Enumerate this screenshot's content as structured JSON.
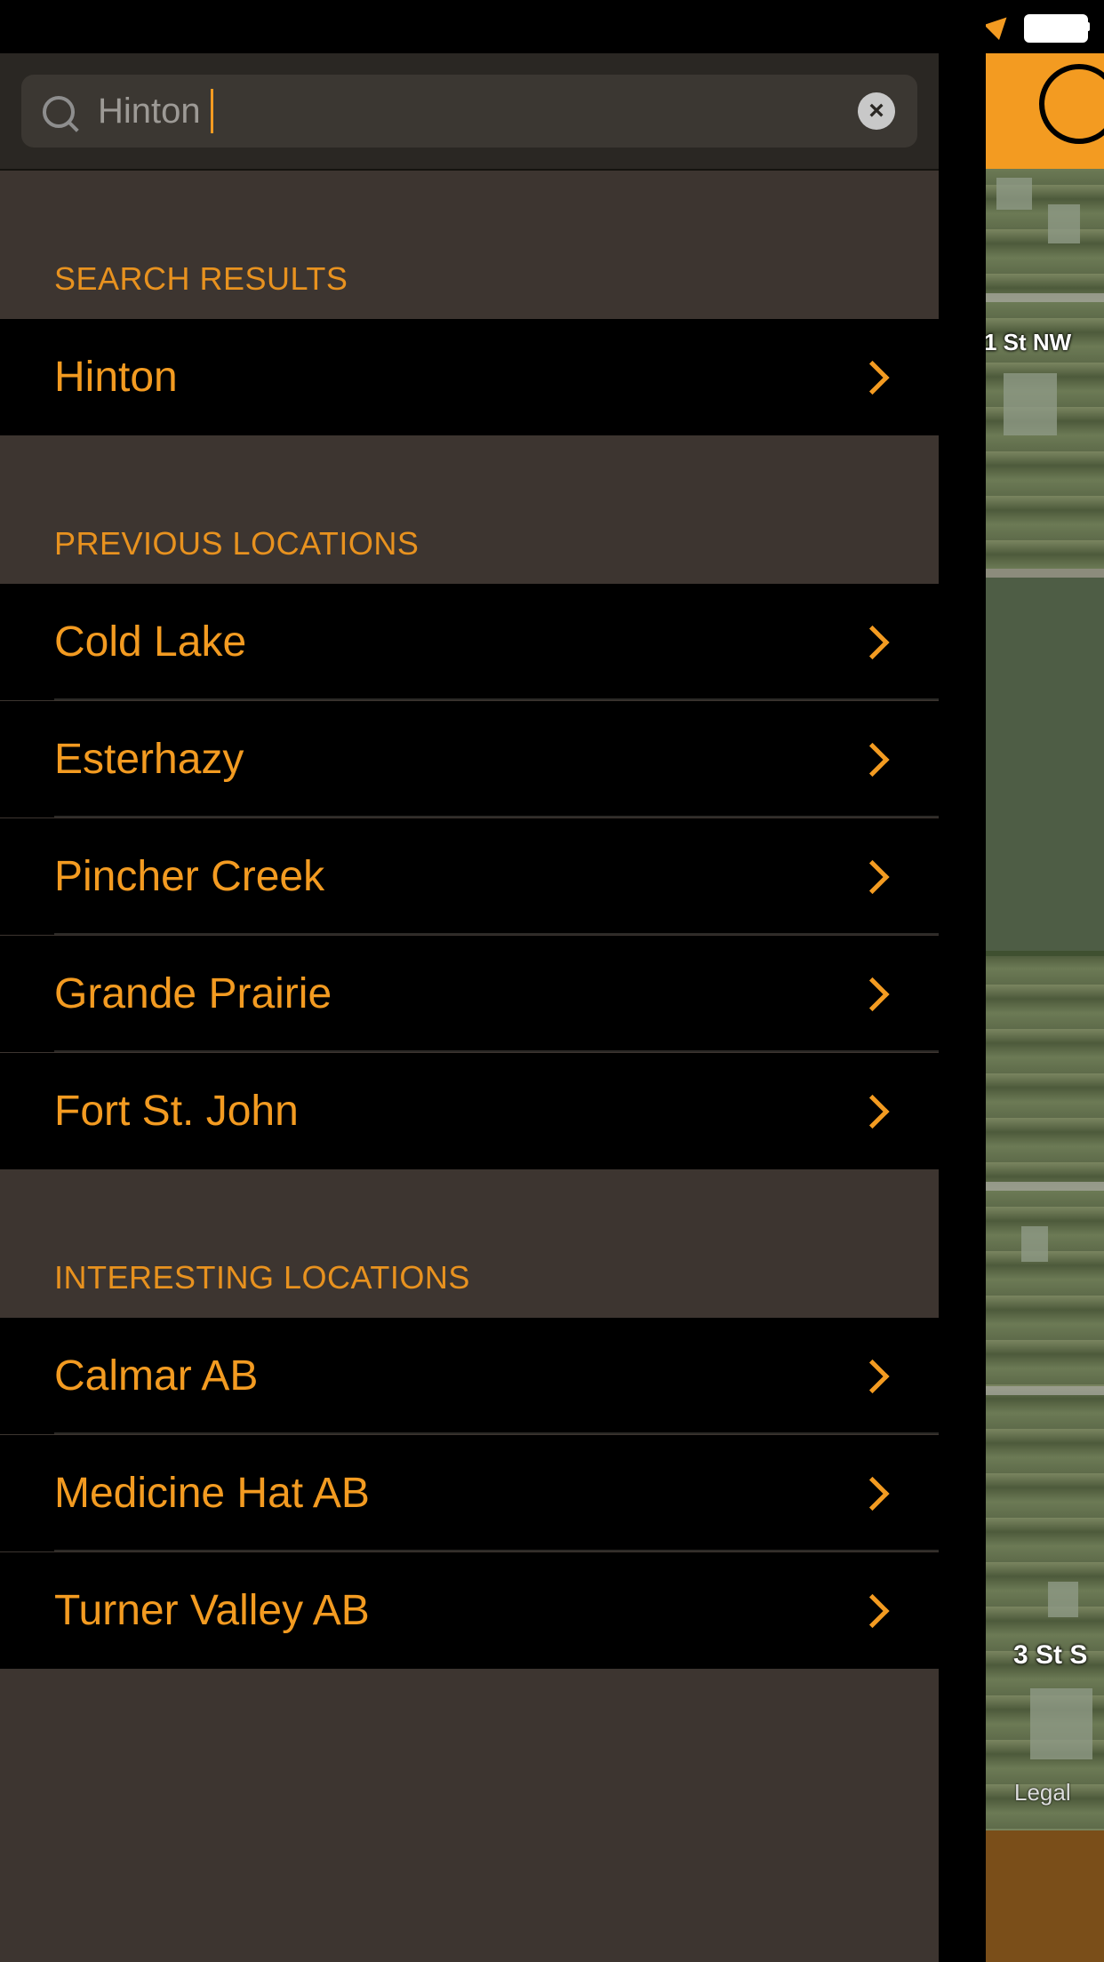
{
  "search": {
    "value": "Hinton",
    "clear_glyph": "×",
    "icon": "search-icon"
  },
  "sections": {
    "search_results": {
      "title": "SEARCH RESULTS",
      "items": [
        {
          "label": "Hinton"
        }
      ]
    },
    "previous_locations": {
      "title": "PREVIOUS LOCATIONS",
      "items": [
        {
          "label": "Cold Lake"
        },
        {
          "label": "Esterhazy"
        },
        {
          "label": "Pincher Creek"
        },
        {
          "label": "Grande Prairie"
        },
        {
          "label": "Fort St. John"
        }
      ]
    },
    "interesting_locations": {
      "title": "INTERESTING LOCATIONS",
      "items": [
        {
          "label": "Calmar AB"
        },
        {
          "label": "Medicine Hat AB"
        },
        {
          "label": "Turner Valley AB"
        }
      ]
    }
  },
  "map": {
    "labels": [
      "1 St NW",
      "3 St S"
    ],
    "legal": "Legal"
  },
  "colors": {
    "accent": "#f39b21",
    "panel_bg": "#3d3530",
    "row_bg": "#000000"
  }
}
